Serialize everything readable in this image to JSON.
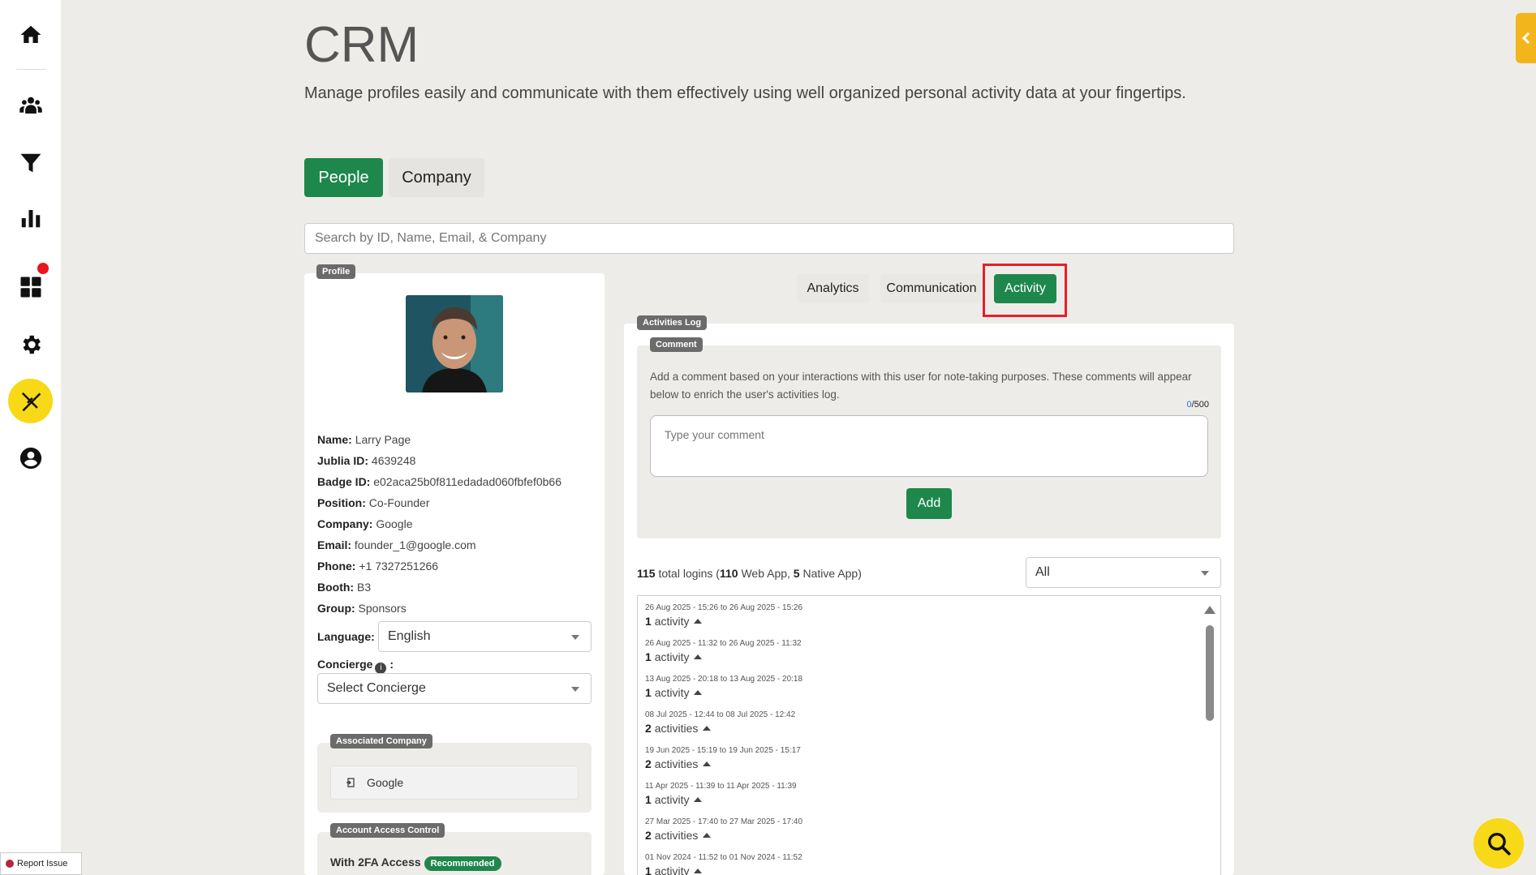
{
  "sidebar": {
    "icons": [
      "home-icon",
      "people-icon",
      "filter-icon",
      "bar-chart-icon",
      "dashboard-icon",
      "gear-icon",
      "tools-icon",
      "account-icon"
    ],
    "report_label": "Report Issue"
  },
  "header": {
    "title": "CRM",
    "subtitle": "Manage profiles easily and communicate with them effectively using well organized personal activity data at your fingertips."
  },
  "tabs": {
    "people": "People",
    "company": "Company"
  },
  "search": {
    "placeholder": "Search by ID, Name, Email, & Company"
  },
  "profile": {
    "tag": "Profile",
    "fields": [
      {
        "label": "Name:",
        "value": "Larry Page"
      },
      {
        "label": "Jublia ID:",
        "value": "4639248"
      },
      {
        "label": "Badge ID:",
        "value": "e02aca25b0f811edadad060fbfef0b66"
      },
      {
        "label": "Position:",
        "value": "Co-Founder"
      },
      {
        "label": "Company:",
        "value": "Google"
      },
      {
        "label": "Email:",
        "value": "founder_1@google.com"
      },
      {
        "label": "Phone:",
        "value": "+1 7327251266"
      },
      {
        "label": "Booth:",
        "value": "B3"
      },
      {
        "label": "Group:",
        "value": "Sponsors"
      }
    ],
    "language_label": "Language:",
    "language_value": "English",
    "concierge_label": "Concierge",
    "concierge_suffix": ":",
    "concierge_value": "Select Concierge",
    "associated_company_tag": "Associated Company",
    "associated_company": "Google",
    "access_control_tag": "Account Access Control",
    "twofa_label": "With 2FA Access",
    "twofa_badge": "Recommended"
  },
  "right_tabs": {
    "analytics": "Analytics",
    "communication": "Communication",
    "activity": "Activity"
  },
  "activities": {
    "tag": "Activities Log",
    "comment_tag": "Comment",
    "comment_desc": "Add a comment based on your interactions with this user for note-taking purposes. These comments will appear below to enrich the user's activities log.",
    "counter_current": "0",
    "counter_max": "/500",
    "comment_placeholder": "Type your comment",
    "add_label": "Add",
    "logins_total": "115",
    "logins_text_1": " total logins (",
    "logins_web": "110",
    "logins_text_2": " Web App, ",
    "logins_native": "5",
    "logins_text_3": " Native App)",
    "filter_value": "All",
    "log": [
      {
        "date": "26 Aug 2025 - 15:26 to 26 Aug 2025 - 15:26",
        "count": "1",
        "unit": "activity"
      },
      {
        "date": "26 Aug 2025 - 11:32 to 26 Aug 2025 - 11:32",
        "count": "1",
        "unit": "activity"
      },
      {
        "date": "13 Aug 2025 - 20:18 to 13 Aug 2025 - 20:18",
        "count": "1",
        "unit": "activity"
      },
      {
        "date": "08 Jul 2025 - 12:44 to 08 Jul 2025 - 12:42",
        "count": "2",
        "unit": "activities"
      },
      {
        "date": "19 Jun 2025 - 15:19 to 19 Jun 2025 - 15:17",
        "count": "2",
        "unit": "activities"
      },
      {
        "date": "11 Apr 2025 - 11:39 to 11 Apr 2025 - 11:39",
        "count": "1",
        "unit": "activity"
      },
      {
        "date": "27 Mar 2025 - 17:40 to 27 Mar 2025 - 17:40",
        "count": "2",
        "unit": "activities"
      },
      {
        "date": "01 Nov 2024 - 11:52 to 01 Nov 2024 - 11:52",
        "count": "1",
        "unit": "activity"
      }
    ]
  },
  "colors": {
    "primary": "#1e874b",
    "accent": "#f7d917",
    "highlight": "#e3202a",
    "notification": "#e8151b"
  }
}
